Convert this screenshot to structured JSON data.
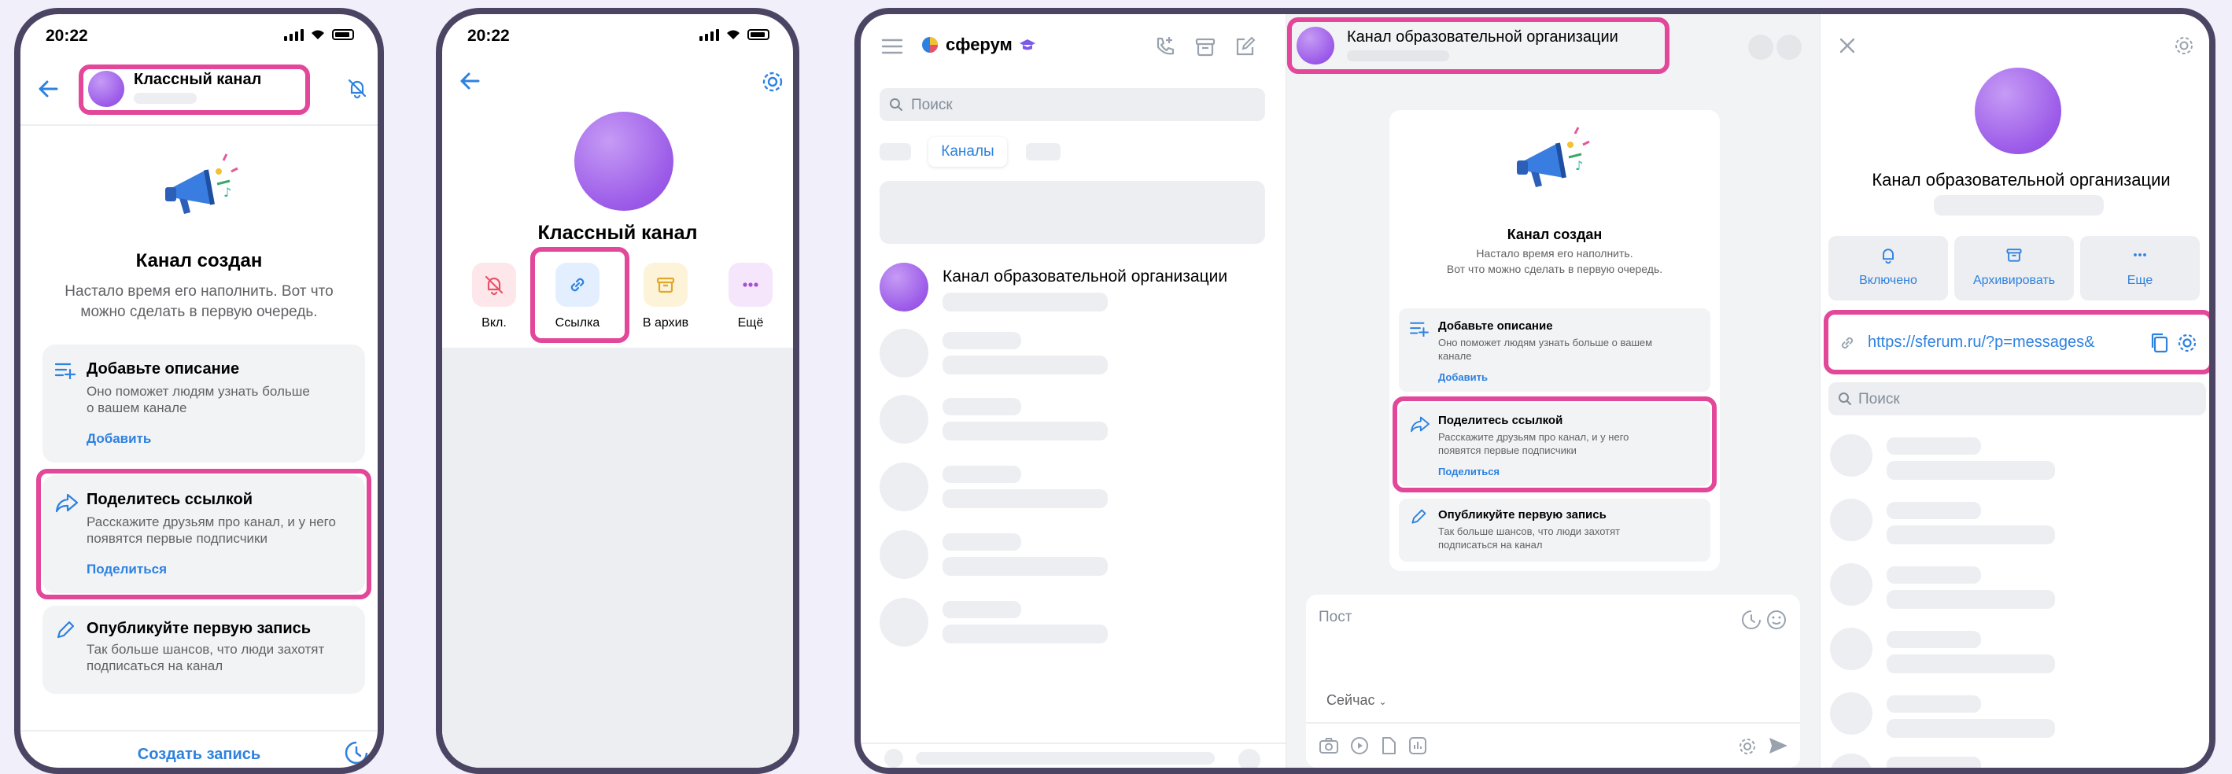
{
  "phone1": {
    "time": "20:22",
    "channel_title": "Классный канал",
    "created_title": "Канал создан",
    "created_text_1": "Настало время его наполнить. Вот что",
    "created_text_2": "можно сделать в первую очередь.",
    "cards": [
      {
        "title": "Добавьте описание",
        "text_1": "Оно поможет людям узнать больше",
        "text_2": "о вашем канале",
        "link": "Добавить"
      },
      {
        "title": "Поделитесь ссылкой",
        "text_1": "Расскажите друзьям про канал, и у него",
        "text_2": "появятся первые подписчики",
        "link": "Поделиться"
      },
      {
        "title": "Опубликуйте первую запись",
        "text_1": "Так больше шансов, что люди захотят",
        "text_2": "подписаться на канал"
      }
    ],
    "create_post": "Создать запись"
  },
  "phone2": {
    "time": "20:22",
    "channel_title": "Классный канал",
    "actions": [
      {
        "label": "Вкл.",
        "icon": "bell-off-icon",
        "color": "#e8536a"
      },
      {
        "label": "Ссылка",
        "icon": "link-icon",
        "color": "#2d81e0"
      },
      {
        "label": "В архив",
        "icon": "archive-icon",
        "color": "#e0a829"
      },
      {
        "label": "Ещё",
        "icon": "more-icon",
        "color": "#a451d6"
      }
    ]
  },
  "desktop": {
    "logo": "сферум",
    "search_placeholder": "Поиск",
    "tab_channels": "Каналы",
    "chat_title": "Канал образовательной организации",
    "header_title": "Канал образовательной организации",
    "created_title": "Канал создан",
    "created_text_1": "Настало время его наполнить.",
    "created_text_2": "Вот что можно сделать в первую очередь.",
    "cards": [
      {
        "title": "Добавьте описание",
        "text_1": "Оно поможет людям узнать больше о вашем",
        "text_2": "канале",
        "link": "Добавить"
      },
      {
        "title": "Поделитесь ссылкой",
        "text_1": "Расскажите друзьям про канал, и у него",
        "text_2": "появятся первые подписчики",
        "link": "Поделиться"
      },
      {
        "title": "Опубликуйте первую запись",
        "text_1": "Так больше шансов, что люди захотят",
        "text_2": "подписаться на канал"
      }
    ],
    "post_placeholder": "Пост",
    "schedule": "Сейчас",
    "info_title": "Канал образовательной организации",
    "info_actions": [
      "Включено",
      "Архивировать",
      "Еще"
    ],
    "link_url": "https://sferum.ru/?p=messages&",
    "members_search": "Поиск"
  },
  "colors": {
    "accent": "#2d81e0",
    "highlight": "#e2479a",
    "frame": "#4b4563"
  }
}
